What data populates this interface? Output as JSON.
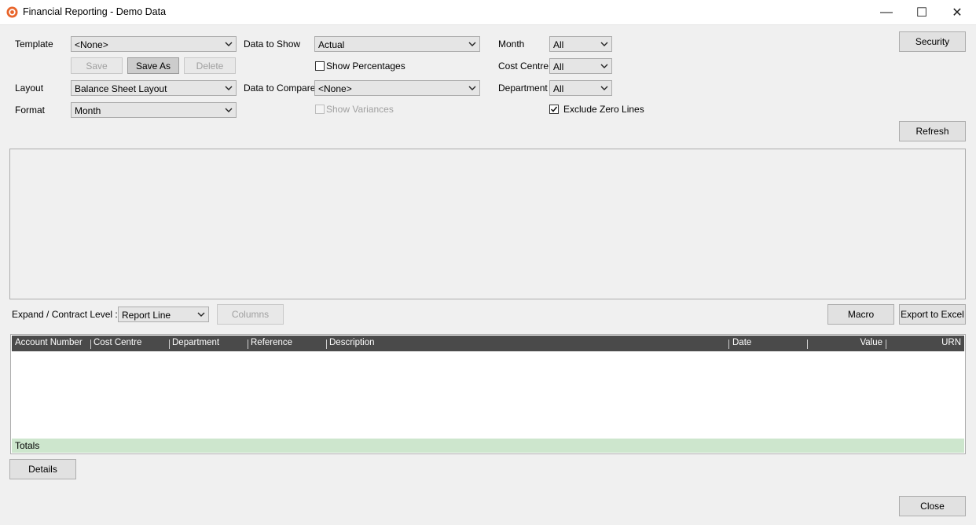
{
  "window": {
    "title": "Financial Reporting - Demo Data",
    "minimize": "—",
    "maximize": "☐",
    "close": "✕"
  },
  "filters": {
    "template_label": "Template",
    "template_value": "<None>",
    "layout_label": "Layout",
    "layout_value": "Balance Sheet Layout",
    "format_label": "Format",
    "format_value": "Month",
    "data_to_show_label": "Data to Show",
    "data_to_show_value": "Actual",
    "show_percentages_label": "Show Percentages",
    "data_to_compare_label": "Data to Compare",
    "data_to_compare_value": "<None>",
    "show_variances_label": "Show Variances",
    "month_label": "Month",
    "month_value": "All",
    "cost_centre_label": "Cost Centre",
    "cost_centre_value": "All",
    "department_label": "Department",
    "department_value": "All",
    "exclude_zero_label": "Exclude Zero Lines"
  },
  "buttons": {
    "save": "Save",
    "save_as": "Save As",
    "delete": "Delete",
    "security": "Security",
    "refresh": "Refresh",
    "columns": "Columns",
    "macro": "Macro",
    "export": "Export to Excel",
    "details": "Details",
    "close": "Close"
  },
  "expand": {
    "label": "Expand / Contract Level :",
    "value": "Report Line"
  },
  "grid": {
    "columns": [
      "Account Number",
      "Cost Centre",
      "Department",
      "Reference",
      "Description",
      "Date",
      "Value",
      "URN"
    ],
    "totals_label": "Totals"
  },
  "state": {
    "show_percentages": false,
    "show_variances": false,
    "exclude_zero_lines": true
  },
  "colors": {
    "accent_icon": "#e8652b",
    "grid_header": "#4a4a4a",
    "totals_row": "#cde6cd"
  }
}
